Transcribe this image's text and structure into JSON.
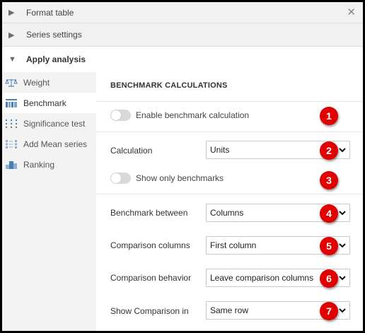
{
  "accordion": {
    "format_table": "Format table",
    "series_settings": "Series settings",
    "apply_analysis": "Apply analysis"
  },
  "sidebar": {
    "items": [
      {
        "label": "Weight",
        "icon": "scale-icon",
        "active": false
      },
      {
        "label": "Benchmark",
        "icon": "benchmark-grid-icon",
        "active": true
      },
      {
        "label": "Significance test",
        "icon": "significance-dots-icon",
        "active": false
      },
      {
        "label": "Add Mean series",
        "icon": "mean-series-icon",
        "active": false
      },
      {
        "label": "Ranking",
        "icon": "ranking-icon",
        "active": false
      }
    ]
  },
  "main": {
    "section_title": "BENCHMARK CALCULATIONS",
    "enable_toggle_label": "Enable benchmark calculation",
    "show_only_label": "Show only benchmarks",
    "calculation": {
      "label": "Calculation",
      "value": "Units"
    },
    "benchmark_between": {
      "label": "Benchmark between",
      "value": "Columns"
    },
    "comparison_columns": {
      "label": "Comparison columns",
      "value": "First column"
    },
    "comparison_behavior": {
      "label": "Comparison behavior",
      "value": "Leave comparison columns"
    },
    "show_comparison_in": {
      "label": "Show Comparison in",
      "value": "Same row"
    }
  },
  "badges": [
    "1",
    "2",
    "3",
    "4",
    "5",
    "6",
    "7"
  ],
  "colors": {
    "badge": "#e00000",
    "sidebar_bg": "#f3f3f3",
    "accordion_bg": "#f1f1f1",
    "toggle_off": "#d9d9d9",
    "icon_blue": "#4a7fb5"
  }
}
